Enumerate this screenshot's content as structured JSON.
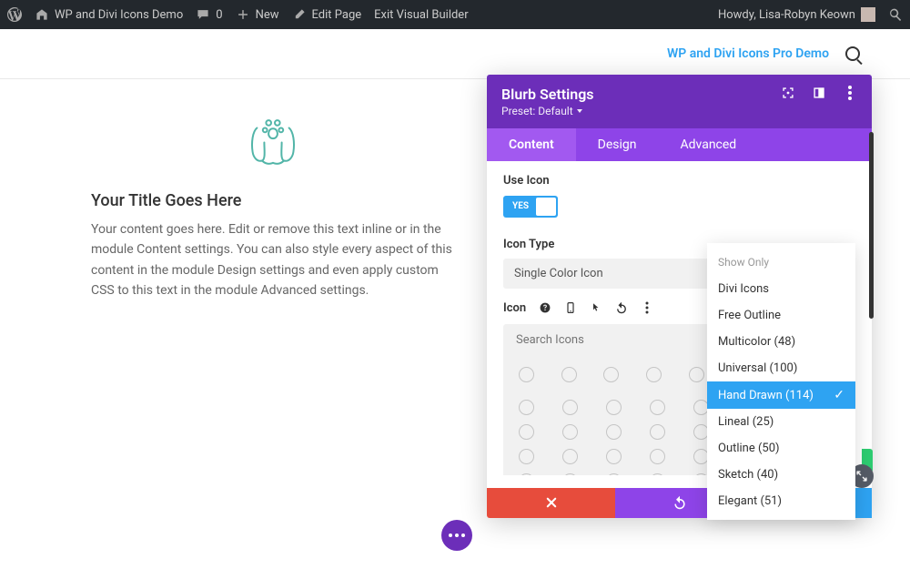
{
  "adminbar": {
    "site_title": "WP and Divi Icons Demo",
    "comments": "0",
    "new": "New",
    "edit_page": "Edit Page",
    "exit_builder": "Exit Visual Builder",
    "howdy": "Howdy, Lisa-Robyn Keown"
  },
  "sitebar": {
    "link": "WP and Divi Icons Pro Demo"
  },
  "blurb": {
    "title": "Your Title Goes Here",
    "body": "Your content goes here. Edit or remove this text inline or in the module Content settings. You can also style every aspect of this content in the module Design settings and even apply custom CSS to this text in the module Advanced settings."
  },
  "panel": {
    "title": "Blurb Settings",
    "preset": "Preset: Default",
    "tabs": [
      "Content",
      "Design",
      "Advanced"
    ],
    "use_icon_label": "Use Icon",
    "toggle_yes": "YES",
    "icon_type_label": "Icon Type",
    "icon_type_value": "Single Color Icon",
    "icon_label": "Icon",
    "search_placeholder": "Search Icons"
  },
  "dropdown": {
    "header": "Show Only",
    "items": [
      "Divi Icons",
      "Free Outline",
      "Multicolor (48)",
      "Universal (100)",
      "Hand Drawn (114)",
      "Lineal (25)",
      "Outline (50)",
      "Sketch (40)",
      "Elegant (51)"
    ],
    "selected_index": 4
  }
}
